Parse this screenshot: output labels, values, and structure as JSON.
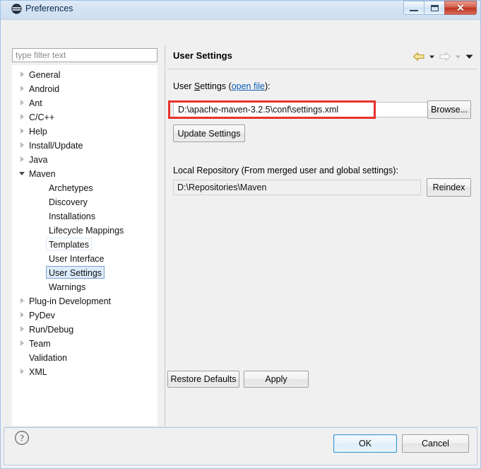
{
  "window": {
    "title": "Preferences",
    "icon": "preferences-icon",
    "controls": {
      "minimize": "minimize-button",
      "maximize": "maximize-button",
      "close": "close-button",
      "close_glyph": "✕"
    },
    "accent_blue": "#9fc2e3",
    "close_red": "#bc3520"
  },
  "filter": {
    "placeholder": "type filter text",
    "value": ""
  },
  "tree": {
    "items": [
      {
        "label": "General",
        "indent": 0,
        "twisty": "collapsed",
        "state": "normal"
      },
      {
        "label": "Android",
        "indent": 0,
        "twisty": "collapsed",
        "state": "normal"
      },
      {
        "label": "Ant",
        "indent": 0,
        "twisty": "collapsed",
        "state": "normal"
      },
      {
        "label": "C/C++",
        "indent": 0,
        "twisty": "collapsed",
        "state": "normal"
      },
      {
        "label": "Help",
        "indent": 0,
        "twisty": "collapsed",
        "state": "normal"
      },
      {
        "label": "Install/Update",
        "indent": 0,
        "twisty": "collapsed",
        "state": "normal"
      },
      {
        "label": "Java",
        "indent": 0,
        "twisty": "collapsed",
        "state": "normal"
      },
      {
        "label": "Maven",
        "indent": 0,
        "twisty": "expanded",
        "state": "normal"
      },
      {
        "label": "Archetypes",
        "indent": 1,
        "twisty": "none",
        "state": "normal"
      },
      {
        "label": "Discovery",
        "indent": 1,
        "twisty": "none",
        "state": "normal"
      },
      {
        "label": "Installations",
        "indent": 1,
        "twisty": "none",
        "state": "normal"
      },
      {
        "label": "Lifecycle Mappings",
        "indent": 1,
        "twisty": "none",
        "state": "normal"
      },
      {
        "label": "Templates",
        "indent": 1,
        "twisty": "none",
        "state": "hovered"
      },
      {
        "label": "User Interface",
        "indent": 1,
        "twisty": "none",
        "state": "normal"
      },
      {
        "label": "User Settings",
        "indent": 1,
        "twisty": "none",
        "state": "selected"
      },
      {
        "label": "Warnings",
        "indent": 1,
        "twisty": "none",
        "state": "normal"
      },
      {
        "label": "Plug-in Development",
        "indent": 0,
        "twisty": "collapsed",
        "state": "normal"
      },
      {
        "label": "PyDev",
        "indent": 0,
        "twisty": "collapsed",
        "state": "normal"
      },
      {
        "label": "Run/Debug",
        "indent": 0,
        "twisty": "collapsed",
        "state": "normal"
      },
      {
        "label": "Team",
        "indent": 0,
        "twisty": "collapsed",
        "state": "normal"
      },
      {
        "label": "Validation",
        "indent": 0,
        "twisty": "none",
        "state": "normal"
      },
      {
        "label": "XML",
        "indent": 0,
        "twisty": "collapsed",
        "state": "normal"
      }
    ]
  },
  "panel": {
    "title": "User Settings",
    "nav": {
      "back_icon": "back-arrow-icon",
      "back_menu_icon": "chevron-down-icon",
      "forward_icon": "forward-arrow-icon",
      "forward_menu_icon": "chevron-down-icon",
      "view_menu_icon": "chevron-down-icon"
    },
    "user_settings": {
      "label_prefix": "User ",
      "label_mnemonic": "S",
      "label_rest": "ettings (",
      "link_text": "open file",
      "label_suffix": "):",
      "path_value": "D:\\apache-maven-3.2.5\\conf\\settings.xml",
      "browse_label": "Browse...",
      "update_label": "Update Settings",
      "annotation_color": "#e8322a"
    },
    "local_repository": {
      "label": "Local Repository (From merged user and global settings):",
      "value": "D:\\Repositories\\Maven",
      "reindex_label": "Reindex"
    },
    "restore_defaults_label": "Restore Defaults",
    "apply_label": "Apply"
  },
  "footer": {
    "help_icon": "help-question-icon",
    "ok_label": "OK",
    "cancel_label": "Cancel"
  }
}
